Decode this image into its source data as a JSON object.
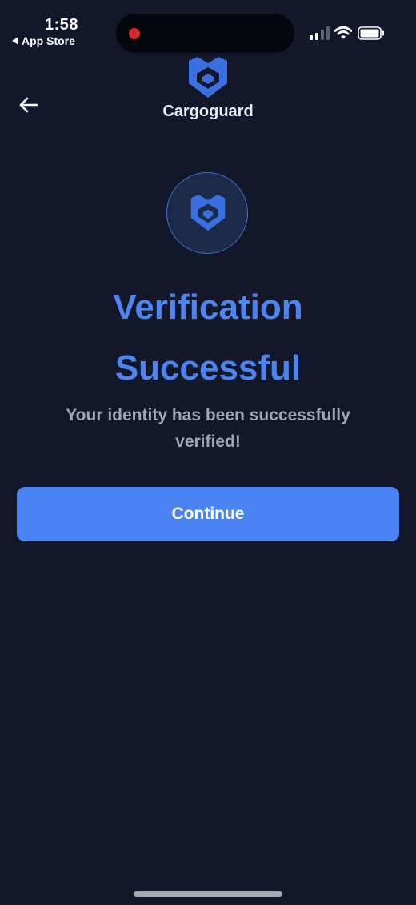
{
  "status_bar": {
    "time": "1:58",
    "back_app": "App Store"
  },
  "header": {
    "back_icon": "arrow-left-icon",
    "logo_icon": "shield-logo-icon",
    "brand": "Cargoguard"
  },
  "main": {
    "badge_icon": "shield-logo-icon",
    "title": "Verification Successful",
    "subtitle": "Your identity has been successfully verified!",
    "continue_label": "Continue"
  },
  "colors": {
    "background": "#121729",
    "accent": "#4b84f2",
    "title": "#4d84f0",
    "subtitle": "#a0a4b6"
  }
}
